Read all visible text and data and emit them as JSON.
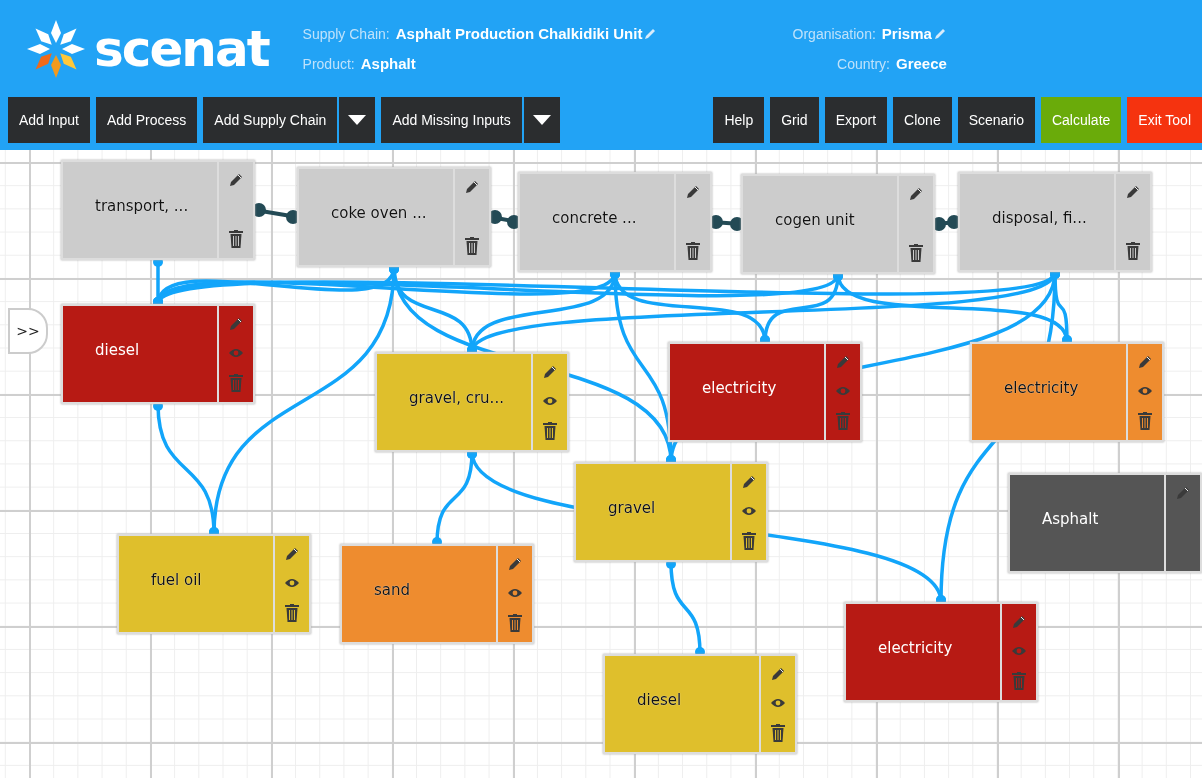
{
  "header": {
    "logo": "scenat",
    "fields": [
      {
        "label": "Supply Chain:",
        "value": "Asphalt Production Chalkidiki Unit",
        "editable": true
      },
      {
        "label": "Product:",
        "value": "Asphalt",
        "editable": false
      },
      {
        "label": "Organisation:",
        "value": "Prisma",
        "editable": true
      },
      {
        "label": "Country:",
        "value": "Greece",
        "editable": false
      }
    ]
  },
  "toolbar": {
    "left": [
      {
        "label": "Add Input",
        "kind": "plain"
      },
      {
        "label": "Add Process",
        "kind": "plain"
      },
      {
        "label": "Add Supply Chain",
        "kind": "dropdown"
      },
      {
        "label": "Add Missing Inputs",
        "kind": "dropdown"
      }
    ],
    "right": [
      {
        "label": "Help",
        "kind": "plain"
      },
      {
        "label": "Grid",
        "kind": "plain"
      },
      {
        "label": "Export",
        "kind": "plain"
      },
      {
        "label": "Clone",
        "kind": "plain"
      },
      {
        "label": "Scenario",
        "kind": "plain"
      },
      {
        "label": "Calculate",
        "kind": "plain",
        "color": "#6aab0a"
      },
      {
        "label": "Exit Tool",
        "kind": "plain",
        "color": "#f5330f"
      }
    ]
  },
  "sidebar_toggle": ">>",
  "nodes": [
    {
      "label": "transport, ...",
      "kind": "process",
      "color": "#cccccc"
    },
    {
      "label": "coke oven ...",
      "kind": "process",
      "color": "#cccccc"
    },
    {
      "label": "concrete ...",
      "kind": "process",
      "color": "#cccccc"
    },
    {
      "label": "cogen unit",
      "kind": "process",
      "color": "#cccccc"
    },
    {
      "label": "disposal, fi...",
      "kind": "process",
      "color": "#cccccc"
    },
    {
      "label": "diesel",
      "kind": "input",
      "color": "#b71a14"
    },
    {
      "label": "gravel, cru...",
      "kind": "input",
      "color": "#dfbf2c"
    },
    {
      "label": "electricity",
      "kind": "input",
      "color": "#b71a14"
    },
    {
      "label": "electricity",
      "kind": "input",
      "color": "#ee8c2f"
    },
    {
      "label": "gravel",
      "kind": "input",
      "color": "#dfbf2c"
    },
    {
      "label": "Asphalt",
      "kind": "product",
      "color": "#555555"
    },
    {
      "label": "fuel oil",
      "kind": "input",
      "color": "#dfbf2c"
    },
    {
      "label": "sand",
      "kind": "input",
      "color": "#ee8c2f"
    },
    {
      "label": "diesel",
      "kind": "input",
      "color": "#dfbf2c"
    },
    {
      "label": "electricity",
      "kind": "input",
      "color": "#b71a14"
    }
  ]
}
